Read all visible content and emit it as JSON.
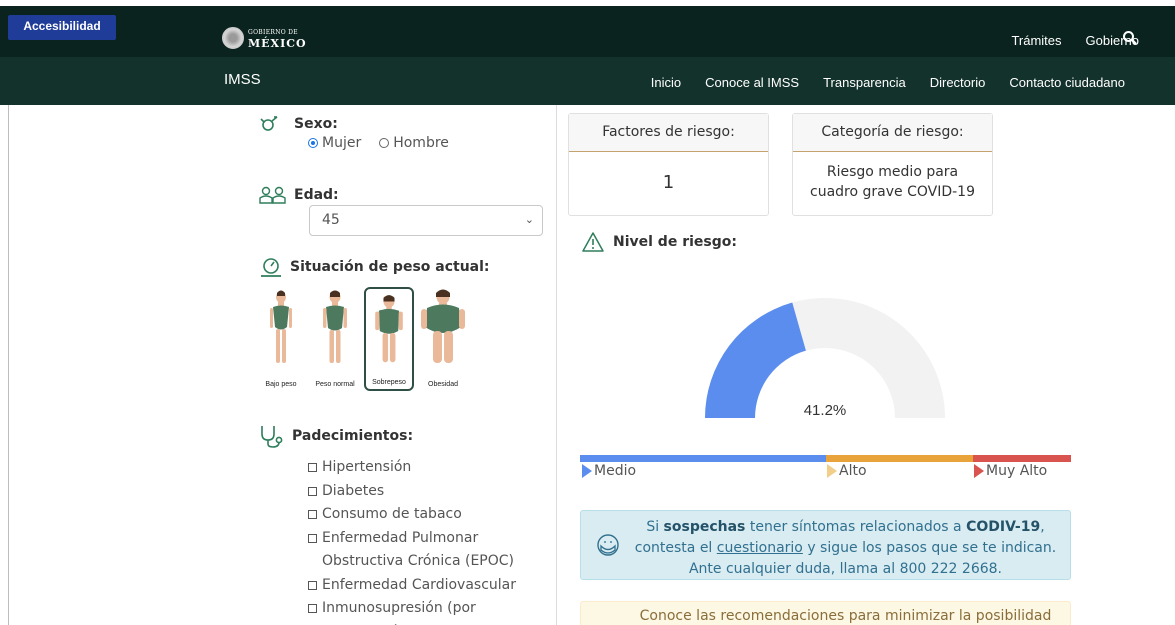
{
  "topbar": {
    "accessibility_label": "Accesibilidad",
    "logo_small": "GOBIERNO DE",
    "logo_big": "MÉXICO",
    "links": [
      "Trámites",
      "Gobierno"
    ],
    "search_icon": "search-icon"
  },
  "navbar": {
    "brand": "IMSS",
    "links": [
      "Inicio",
      "Conoce al IMSS",
      "Transparencia",
      "Directorio",
      "Contacto ciudadano"
    ]
  },
  "form": {
    "sexo": {
      "label": "Sexo:",
      "options": [
        "Mujer",
        "Hombre"
      ],
      "selected": "Mujer"
    },
    "edad": {
      "label": "Edad:",
      "value": "45"
    },
    "peso": {
      "label": "Situación de peso actual:",
      "options": [
        "Bajo peso",
        "Peso normal",
        "Sobrepeso",
        "Obesidad"
      ],
      "selected": "Sobrepeso"
    },
    "padecimientos": {
      "label": "Padecimientos:",
      "items": [
        "Hipertensión",
        "Diabetes",
        "Consumo de tabaco",
        "Enfermedad Pulmonar Obstructiva Crónica (EPOC)",
        "Enfermedad Cardiovascular",
        "Inmunosupresión (por ejemplo cáncer, lupus, etc.)"
      ]
    }
  },
  "results": {
    "factores_title": "Factores de riesgo:",
    "factores_value": "1",
    "categoria_title": "Categoría de riesgo:",
    "categoria_value": "Riesgo medio para cuadro grave COVID-19",
    "nivel_label": "Nivel de riesgo:",
    "gauge_value": 41.2,
    "gauge_text": "41.2%",
    "legend": [
      {
        "label": "Medio",
        "color": "#5b8def"
      },
      {
        "label": "Alto",
        "color": "#e8a33a"
      },
      {
        "label": "Muy Alto",
        "color": "#d9534f"
      }
    ]
  },
  "info_box": {
    "p1": "Si ",
    "strong1": "sospechas",
    "p2": " tener síntomas relacionados a ",
    "strong2": "CODIV-19",
    "p3": ",",
    "p4": "contesta el ",
    "link": "cuestionario",
    "p5": " y sigue los pasos que se te indican.",
    "p6": "Ante cualquier duda, llama al 800 222 2668."
  },
  "warn_box": {
    "text": "Conoce las recomendaciones para minimizar la posibilidad"
  },
  "colors": {
    "topbar": "#0b231e",
    "navbar": "#13322b",
    "gauge_fill": "#5b8def",
    "gauge_bg": "#f2f2f2"
  }
}
